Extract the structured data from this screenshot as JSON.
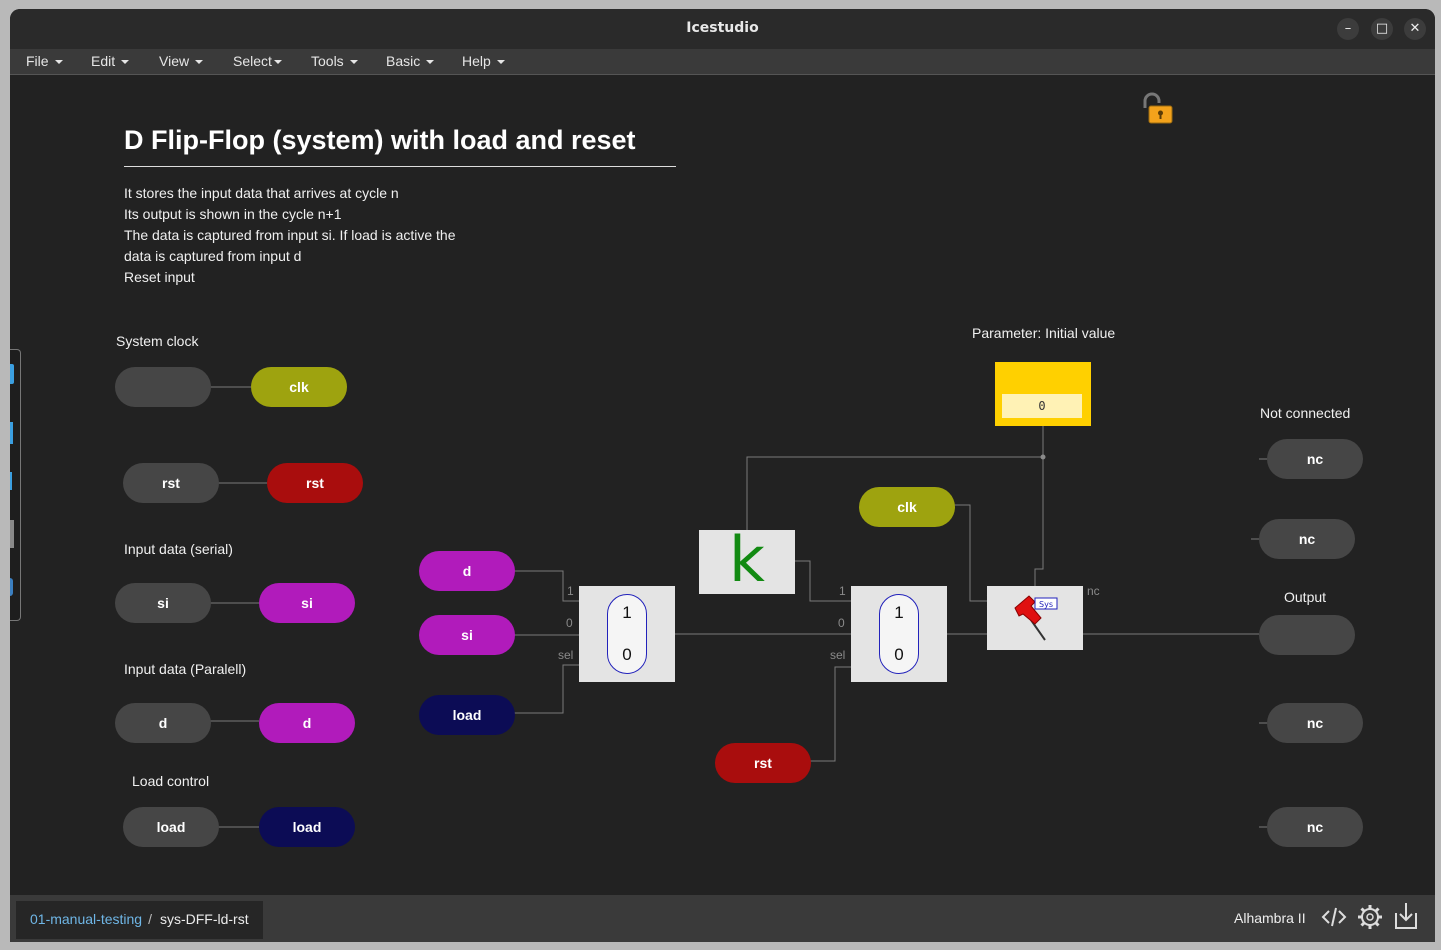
{
  "window": {
    "title": "Icestudio",
    "controls": {
      "minimize": "–",
      "maximize": "□",
      "close": "✕"
    }
  },
  "menubar": {
    "items": [
      {
        "label": "File"
      },
      {
        "label": "Edit"
      },
      {
        "label": "View"
      },
      {
        "label": "Select"
      },
      {
        "label": "Tools"
      },
      {
        "label": "Basic"
      },
      {
        "label": "Help"
      }
    ]
  },
  "canvas": {
    "title": "D Flip-Flop (system) with load and reset",
    "description": [
      "It stores the input data that arrives at cycle n",
      "Its output is shown in the cycle n+1",
      "The data is captured from input si. If load is active the",
      "data is captured from input d",
      "Reset input"
    ],
    "labels": {
      "system_clock": "System clock",
      "input_serial": "Input data (serial)",
      "input_parallel": "Input data (Paralell)",
      "load_control": "Load control",
      "parameter": "Parameter: Initial value",
      "not_connected": "Not connected",
      "output": "Output"
    },
    "inputs": {
      "clk_in": "",
      "clk_label": "clk",
      "rst_in": "rst",
      "rst_label": "rst",
      "si_in": "si",
      "si_label": "si",
      "d_in": "d",
      "d_label": "d",
      "load_in": "load",
      "load_label": "load"
    },
    "circuit": {
      "d": "d",
      "si": "si",
      "load": "load",
      "clk": "clk",
      "rst": "rst",
      "const_k": "k",
      "mux1_top": "1",
      "mux1_bottom": "0",
      "mux2_top": "1",
      "mux2_bottom": "0",
      "port_1": "1",
      "port_0": "0",
      "port_sel": "sel",
      "port_nc": "nc",
      "sys_badge": "Sys",
      "param_value": "0"
    },
    "outputs": {
      "nc1": "nc",
      "nc2": "nc",
      "output": "",
      "nc3": "nc",
      "nc4": "nc"
    }
  },
  "statusbar": {
    "breadcrumb_parent": "01-manual-testing",
    "breadcrumb_separator": "/",
    "breadcrumb_current": "sys-DFF-ld-rst",
    "board": "Alhambra II"
  },
  "colors": {
    "background": "#222222",
    "wire": "#7a7a7a",
    "clock": "#9ea30f",
    "reset": "#a90d0d",
    "data": "#b11bbb",
    "load": "#0c0c55",
    "parameter": "#ffd000",
    "link": "#6fb6e6"
  },
  "icons": [
    "unlock-icon",
    "code-icon",
    "gear-icon",
    "download-icon",
    "pushpin-icon"
  ]
}
